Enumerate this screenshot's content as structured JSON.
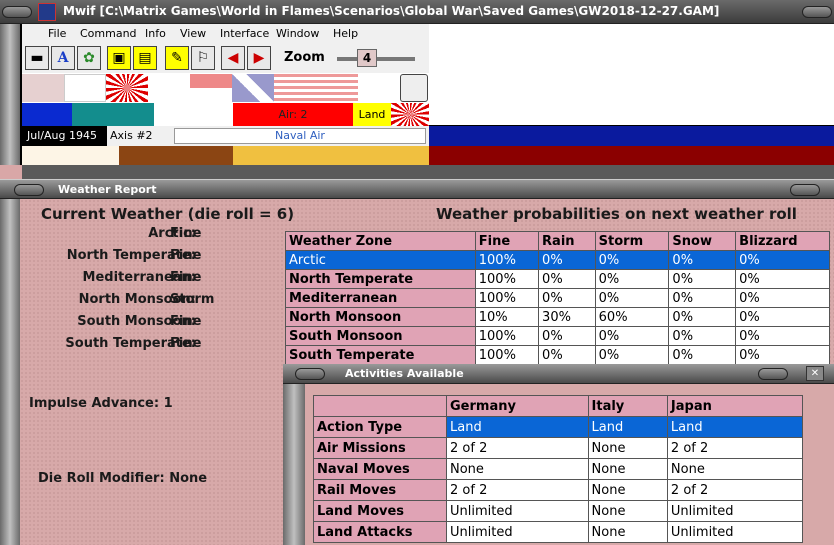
{
  "app": {
    "title": "Mwif [C:\\Matrix Games\\World in Flames\\Scenarios\\Global War\\Saved Games\\GW2018-12-27.GAM]"
  },
  "menu": {
    "file": "File",
    "command": "Command",
    "info": "Info",
    "view": "View",
    "interface": "Interface",
    "window": "Window",
    "help": "Help"
  },
  "toolbar": {
    "zoom_label": "Zoom",
    "zoom_value": "4"
  },
  "status": {
    "air": "Air: 2",
    "land": "Land",
    "date": "Jul/Aug 1945",
    "axis": "Axis #2",
    "mode": "Naval Air"
  },
  "weather_window": {
    "title": "Weather Report",
    "current_title": "Current Weather (die roll = 6)",
    "prob_title": "Weather probabilities on next weather roll",
    "current": [
      {
        "zone": "Arctic:",
        "value": "Fine"
      },
      {
        "zone": "North Temperate:",
        "value": "Fine"
      },
      {
        "zone": "Mediterranean:",
        "value": "Fine"
      },
      {
        "zone": "North Monsoon:",
        "value": "Storm"
      },
      {
        "zone": "South Monsoon:",
        "value": "Fine"
      },
      {
        "zone": "South Temperate:",
        "value": "Fine"
      }
    ],
    "impulse_advance_label": "Impulse Advance:",
    "impulse_advance_value": "1",
    "die_roll_modifier_label": "Die Roll Modifier:",
    "die_roll_modifier_value": "None",
    "prob_headers": [
      "Weather Zone",
      "Fine",
      "Rain",
      "Storm",
      "Snow",
      "Blizzard"
    ],
    "prob_rows": [
      [
        "Arctic",
        "100%",
        "0%",
        "0%",
        "0%",
        "0%"
      ],
      [
        "North Temperate",
        "100%",
        "0%",
        "0%",
        "0%",
        "0%"
      ],
      [
        "Mediterranean",
        "100%",
        "0%",
        "0%",
        "0%",
        "0%"
      ],
      [
        "North Monsoon",
        "10%",
        "30%",
        "60%",
        "0%",
        "0%"
      ],
      [
        "South Monsoon",
        "100%",
        "0%",
        "0%",
        "0%",
        "0%"
      ],
      [
        "South Temperate",
        "100%",
        "0%",
        "0%",
        "0%",
        "0%"
      ]
    ]
  },
  "activities_window": {
    "title": "Activities Available",
    "close": "✕",
    "headers": [
      "",
      "Germany",
      "Italy",
      "Japan"
    ],
    "rows": [
      [
        "Action Type",
        "Land",
        "Land",
        "Land"
      ],
      [
        "Air Missions",
        "2 of 2",
        "None",
        "2 of 2"
      ],
      [
        "Naval Moves",
        "None",
        "None",
        "None"
      ],
      [
        "Rail Moves",
        "2 of 2",
        "None",
        "2 of 2"
      ],
      [
        "Land Moves",
        "Unlimited",
        "None",
        "Unlimited"
      ],
      [
        "Land Attacks",
        "Unlimited",
        "None",
        "Unlimited"
      ]
    ]
  },
  "colors": {
    "selection": "#0a66d6",
    "header_pink": "#e0a3b5",
    "window_bg": "#d7a9a9"
  }
}
